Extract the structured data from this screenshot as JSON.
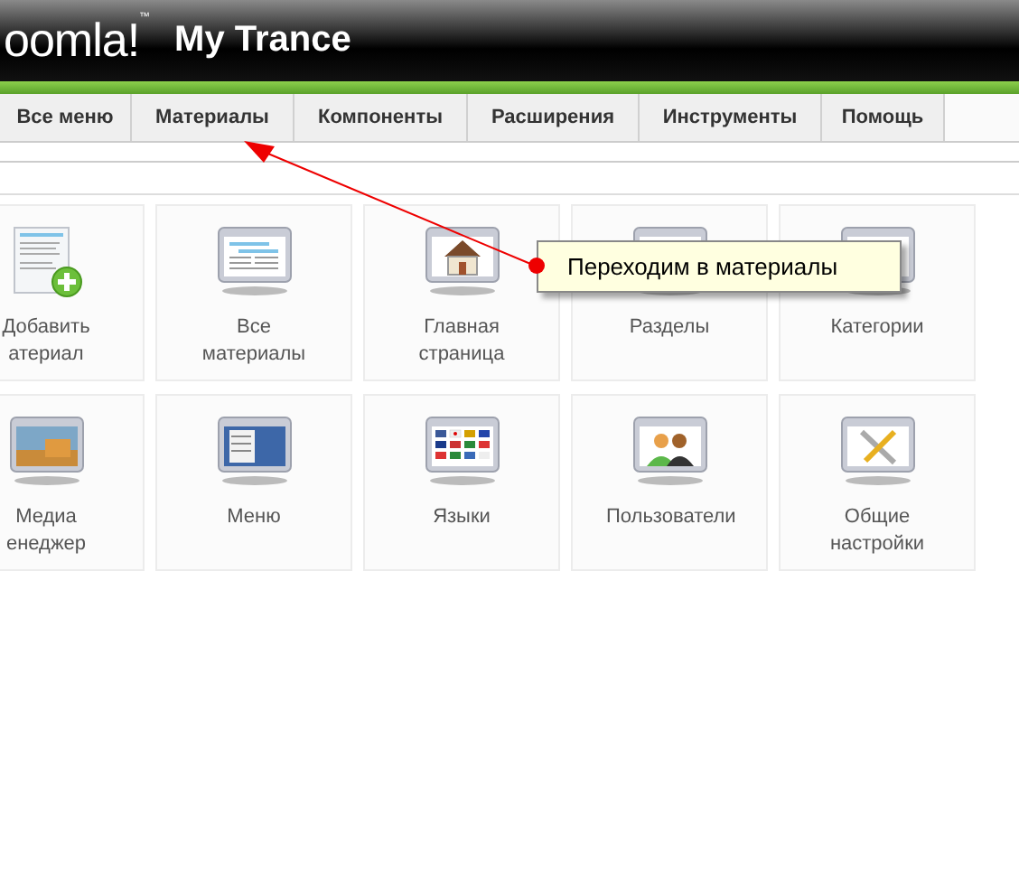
{
  "header": {
    "logo": "oomla!",
    "logo_mark": "™",
    "site_title": "My Trance"
  },
  "menu": [
    {
      "label": "Все меню",
      "selected": false
    },
    {
      "label": "Материалы",
      "selected": false
    },
    {
      "label": "Компоненты",
      "selected": false
    },
    {
      "label": "Расширения",
      "selected": false
    },
    {
      "label": "Инструменты",
      "selected": false
    },
    {
      "label": "Помощь",
      "selected": false
    }
  ],
  "tiles": [
    {
      "kind": "add",
      "label": "Добавить атериал"
    },
    {
      "kind": "articles",
      "label": "Все материалы"
    },
    {
      "kind": "home",
      "label": "Главная страница"
    },
    {
      "kind": "window",
      "label": "Разделы"
    },
    {
      "kind": "window",
      "label": "Категории"
    },
    {
      "kind": "media",
      "label": "Медиа енеджер"
    },
    {
      "kind": "menu",
      "label": "Меню"
    },
    {
      "kind": "flags",
      "label": "Языки"
    },
    {
      "kind": "users",
      "label": "Пользователи"
    },
    {
      "kind": "tools",
      "label": "Общие настройки"
    }
  ],
  "callout": {
    "text": "Переходим в материалы"
  }
}
